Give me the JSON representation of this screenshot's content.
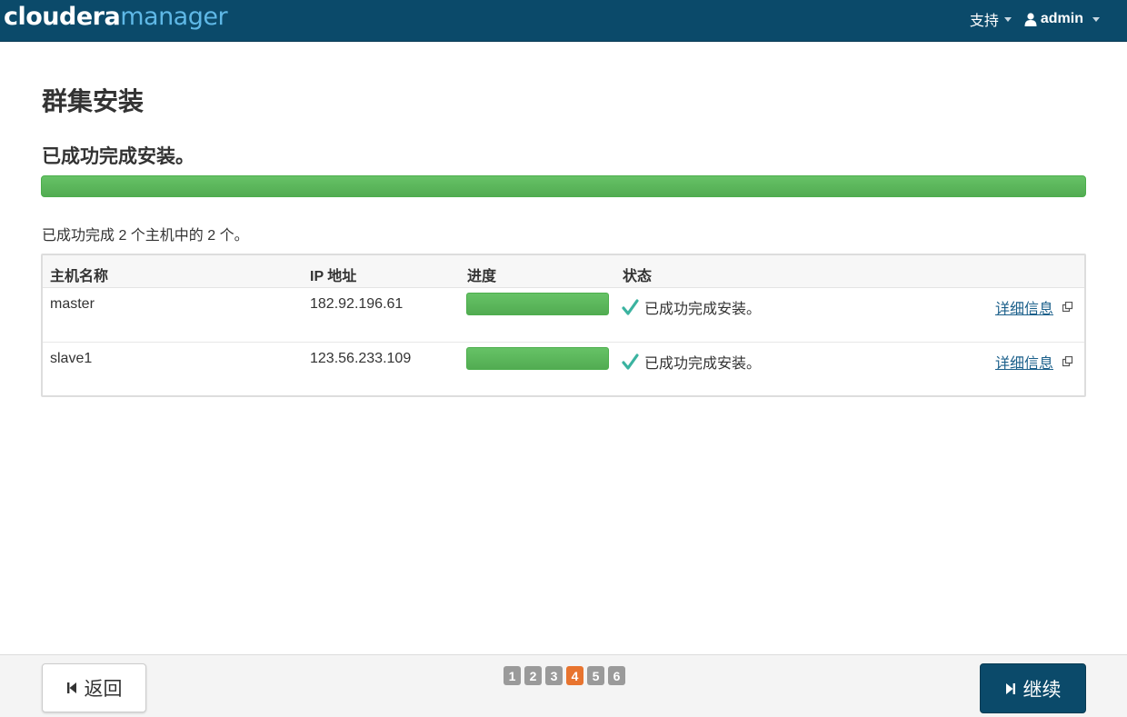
{
  "brand": {
    "part1": "cloudera",
    "part2": "manager"
  },
  "nav": {
    "support": "支持",
    "user": "admin"
  },
  "page": {
    "title": "群集安装",
    "status_heading": "已成功完成安装。",
    "overall_progress": 1.0,
    "summary": "已成功完成 2 个主机中的 2 个。"
  },
  "table": {
    "headers": {
      "host": "主机名称",
      "ip": "IP 地址",
      "progress": "进度",
      "status": "状态"
    },
    "rows": [
      {
        "host": "master",
        "ip": "182.92.196.61",
        "progress": 1.0,
        "status": "已成功完成安装。",
        "details": "详细信息"
      },
      {
        "host": "slave1",
        "ip": "123.56.233.109",
        "progress": 1.0,
        "status": "已成功完成安装。",
        "details": "详细信息"
      }
    ]
  },
  "footer": {
    "back": "返回",
    "next": "继续",
    "steps": [
      "1",
      "2",
      "3",
      "4",
      "5",
      "6"
    ],
    "current_step": "4"
  },
  "colors": {
    "navbar": "#0b4a6a",
    "brand_accent": "#5fb8e6",
    "progress": "#5cb85c",
    "active_step": "#e8742f",
    "check": "#3bb3a0",
    "link": "#1a5f8a"
  },
  "icons": {
    "user": "user-icon",
    "check": "check-icon",
    "external": "external-link-icon",
    "back": "skip-back-icon",
    "next": "skip-forward-icon"
  }
}
